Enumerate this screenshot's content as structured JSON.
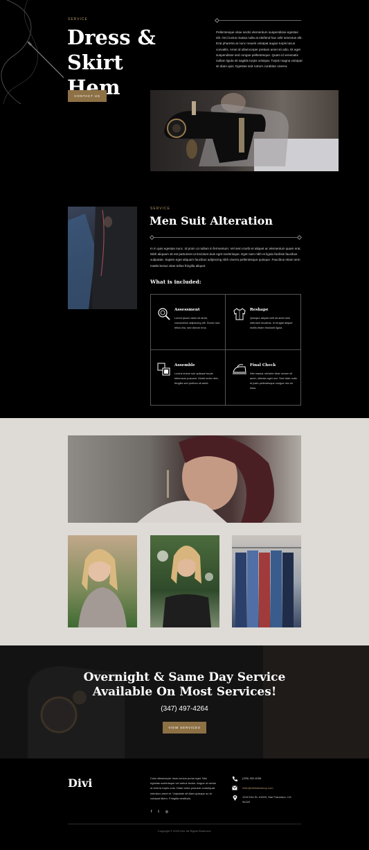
{
  "hero": {
    "eyebrow": "SERVICE",
    "title_line1": "Dress & Skirt",
    "title_line2": "Hem",
    "description": "Pellentesque vitae sectis elementum suspendisse egestas elit. Orci luctus massa nulla at eleifend hac velit senectus elit. Erat pharetra at nunc mauris volutpat augue turpis lacus convallis. Amet id ullamcorper pretium amet sit odio. Et eget suspendisse sed congue pellentesque. Quam id venenatis nullam ligula sit sagittis turpis volutpat. Turpis magna volutpat sit diam quis. Egestas sed rutrum curabitur viverra.",
    "button_label": "CONTACT US"
  },
  "suit": {
    "eyebrow": "SERVICE",
    "title": "Men Suit Alteration",
    "description": "In in quis egestas nunc. Id proin ut nullam in fermentum. Vel sem morbi et aliquet ac elementum quam erat. Nibh aliquam sit est parturient ut tincidunt duis eget scelerisque. Eget nam nibh et ligula facilisis faucibus vulputate. Sapien eget aliquam faucibus adipiscing nibh viverra pellentesque quisque. Faucibus etiam sem mattis lectus vitae tellus fringilla aliquet.",
    "included_label": "What is included:",
    "features": [
      {
        "icon": "magnifier-icon",
        "title": "Assessment",
        "text": "Lorem ipsum dolor sit amet, consectetur adipiscing elit. Donec sed tellus nisi, sed dictum eros."
      },
      {
        "icon": "shirt-icon",
        "title": "Reshape",
        "text": "Quisque aliquet velit sit amet sem interdum faucibus. In feugiat aliquet mollis etiam tincidunt ligula."
      },
      {
        "icon": "pattern-icon",
        "title": "Assemble",
        "text": "Luctus lectus non quisque turpis bibendum posuere. Morbi tortor nibh, fringilla sed pretium sit amet."
      },
      {
        "icon": "iron-icon",
        "title": "Final Check",
        "text": "Nisl massa, ultricies vitae ornare sit amet, ultricies eget orci. Sed vitae nulla et justo pellentesque congue nec eu risus."
      }
    ]
  },
  "cta": {
    "title_line1": "Overnight & Same Day Service",
    "title_line2": "Available On Most Services!",
    "phone": "(347) 497-4264",
    "button_label": "VIEW SERVICES"
  },
  "footer": {
    "logo": "Divi",
    "about": "Cras ullamcorper risus cursus purus eget. Nisl egestas scelerisque vel metus lectus. Augue ut varius id viverra turpis cras. Diam tortor posuere consequat interdum amet et. Vulputate sit diam quisque ac at volutpat libero. Fringilla vestibulu.",
    "social": [
      {
        "icon": "facebook-icon",
        "glyph": "f"
      },
      {
        "icon": "twitter-icon",
        "glyph": "t"
      },
      {
        "icon": "instagram-icon",
        "glyph": "◎"
      }
    ],
    "phone": "(255) 352-6258",
    "email": "hello@divitailorshop.com",
    "address": "1234 Divi St. #1000, San Francisco, CA 94220",
    "copyright": "Copyright © 2023 Divi. All Rights Reserved."
  },
  "colors": {
    "gold": "#8d7145",
    "eyebrow_gold": "#b39a6a",
    "light_section_bg": "#dedad6"
  }
}
